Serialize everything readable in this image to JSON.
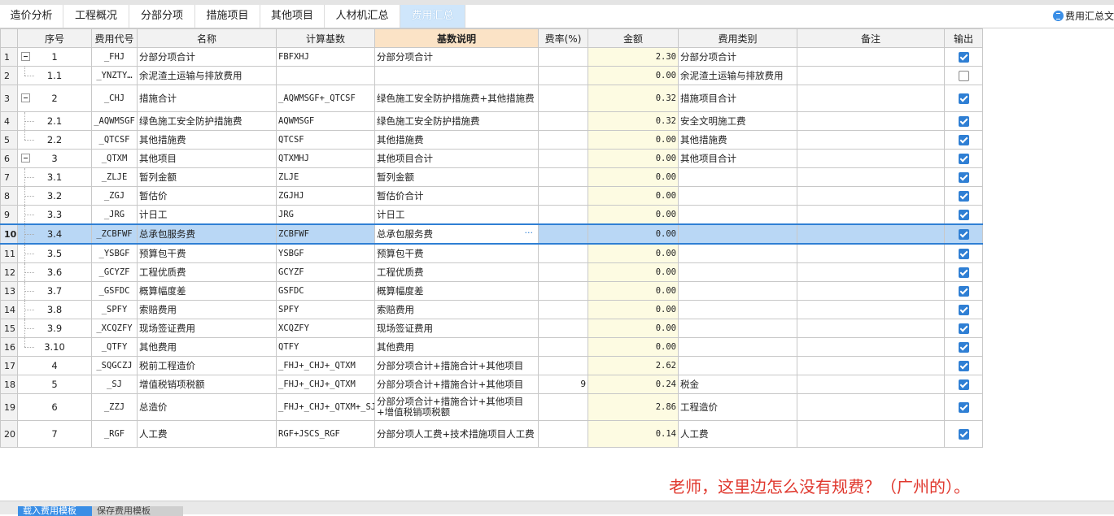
{
  "tabs": [
    {
      "label": "造价分析"
    },
    {
      "label": "工程概况"
    },
    {
      "label": "分部分项"
    },
    {
      "label": "措施项目"
    },
    {
      "label": "其他项目"
    },
    {
      "label": "人材机汇总"
    },
    {
      "label": "费用汇总"
    }
  ],
  "right_link": "费用汇总文",
  "headers": [
    "",
    "序号",
    "费用代号",
    "名称",
    "计算基数",
    "基数说明",
    "费率(%)",
    "金额",
    "费用类别",
    "备注",
    "输出"
  ],
  "rows": [
    {
      "rn": "1",
      "seq": "1",
      "code": "_FHJ",
      "name": "分部分项合计",
      "base": "FBFXHJ",
      "desc": "分部分项合计",
      "rate": "",
      "amount": "2.30",
      "cat": "分部分项合计",
      "note": "",
      "output": true
    },
    {
      "rn": "2",
      "seq": "1.1",
      "code": "_YNZTY…",
      "name": "余泥渣土运输与排放费用",
      "base": "",
      "desc": "",
      "rate": "",
      "amount": "0.00",
      "cat": "余泥渣土运输与排放费用",
      "note": "",
      "output": false
    },
    {
      "rn": "3",
      "seq": "2",
      "code": "_CHJ",
      "name": "措施合计",
      "base": "_AQWMSGF+_QTCSF",
      "desc": "绿色施工安全防护措施费+其他措施费",
      "rate": "",
      "amount": "0.32",
      "cat": "措施项目合计",
      "note": "",
      "output": true
    },
    {
      "rn": "4",
      "seq": "2.1",
      "code": "_AQWMSGF",
      "name": "绿色施工安全防护措施费",
      "base": "AQWMSGF",
      "desc": "绿色施工安全防护措施费",
      "rate": "",
      "amount": "0.32",
      "cat": "安全文明施工费",
      "note": "",
      "output": true
    },
    {
      "rn": "5",
      "seq": "2.2",
      "code": "_QTCSF",
      "name": "其他措施费",
      "base": "QTCSF",
      "desc": "其他措施费",
      "rate": "",
      "amount": "0.00",
      "cat": "其他措施费",
      "note": "",
      "output": true
    },
    {
      "rn": "6",
      "seq": "3",
      "code": "_QTXM",
      "name": "其他项目",
      "base": "QTXMHJ",
      "desc": "其他项目合计",
      "rate": "",
      "amount": "0.00",
      "cat": "其他项目合计",
      "note": "",
      "output": true
    },
    {
      "rn": "7",
      "seq": "3.1",
      "code": "_ZLJE",
      "name": "暂列金额",
      "base": "ZLJE",
      "desc": "暂列金额",
      "rate": "",
      "amount": "0.00",
      "cat": "",
      "note": "",
      "output": true
    },
    {
      "rn": "8",
      "seq": "3.2",
      "code": "_ZGJ",
      "name": "暂估价",
      "base": "ZGJHJ",
      "desc": "暂估价合计",
      "rate": "",
      "amount": "0.00",
      "cat": "",
      "note": "",
      "output": true
    },
    {
      "rn": "9",
      "seq": "3.3",
      "code": "_JRG",
      "name": "计日工",
      "base": "JRG",
      "desc": "计日工",
      "rate": "",
      "amount": "0.00",
      "cat": "",
      "note": "",
      "output": true
    },
    {
      "rn": "10",
      "seq": "3.4",
      "code": "_ZCBFWF",
      "name": "总承包服务费",
      "base": "ZCBFWF",
      "desc": "总承包服务费",
      "rate": "",
      "amount": "0.00",
      "cat": "",
      "note": "",
      "output": true
    },
    {
      "rn": "11",
      "seq": "3.5",
      "code": "_YSBGF",
      "name": "预算包干费",
      "base": "YSBGF",
      "desc": "预算包干费",
      "rate": "",
      "amount": "0.00",
      "cat": "",
      "note": "",
      "output": true
    },
    {
      "rn": "12",
      "seq": "3.6",
      "code": "_GCYZF",
      "name": "工程优质费",
      "base": "GCYZF",
      "desc": "工程优质费",
      "rate": "",
      "amount": "0.00",
      "cat": "",
      "note": "",
      "output": true
    },
    {
      "rn": "13",
      "seq": "3.7",
      "code": "_GSFDC",
      "name": "概算幅度差",
      "base": "GSFDC",
      "desc": "概算幅度差",
      "rate": "",
      "amount": "0.00",
      "cat": "",
      "note": "",
      "output": true
    },
    {
      "rn": "14",
      "seq": "3.8",
      "code": "_SPFY",
      "name": "索赔费用",
      "base": "SPFY",
      "desc": "索赔费用",
      "rate": "",
      "amount": "0.00",
      "cat": "",
      "note": "",
      "output": true
    },
    {
      "rn": "15",
      "seq": "3.9",
      "code": "_XCQZFY",
      "name": "现场签证费用",
      "base": "XCQZFY",
      "desc": "现场签证费用",
      "rate": "",
      "amount": "0.00",
      "cat": "",
      "note": "",
      "output": true
    },
    {
      "rn": "16",
      "seq": "3.10",
      "code": "_QTFY",
      "name": "其他费用",
      "base": "QTFY",
      "desc": "其他费用",
      "rate": "",
      "amount": "0.00",
      "cat": "",
      "note": "",
      "output": true
    },
    {
      "rn": "17",
      "seq": "4",
      "code": "_SQGCZJ",
      "name": "税前工程造价",
      "base": "_FHJ+_CHJ+_QTXM",
      "desc": "分部分项合计+措施合计+其他项目",
      "rate": "",
      "amount": "2.62",
      "cat": "",
      "note": "",
      "output": true
    },
    {
      "rn": "18",
      "seq": "5",
      "code": "_SJ",
      "name": "增值税销项税额",
      "base": "_FHJ+_CHJ+_QTXM",
      "desc": "分部分项合计+措施合计+其他项目",
      "rate": "9",
      "amount": "0.24",
      "cat": "税金",
      "note": "",
      "output": true
    },
    {
      "rn": "19",
      "seq": "6",
      "code": "_ZZJ",
      "name": "总造价",
      "base": "_FHJ+_CHJ+_QTXM+_SJ",
      "desc": "分部分项合计+措施合计+其他项目+增值税销项税额",
      "rate": "",
      "amount": "2.86",
      "cat": "工程造价",
      "note": "",
      "output": true
    },
    {
      "rn": "20",
      "seq": "7",
      "code": "_RGF",
      "name": "人工费",
      "base": "RGF+JSCS_RGF",
      "desc": "分部分项人工费+技术措施项目人工费",
      "rate": "",
      "amount": "0.14",
      "cat": "人工费",
      "note": "",
      "output": true
    }
  ],
  "comment": "老师，这里边怎么没有规费？（广州的）。",
  "bottom_buttons": [
    {
      "label": "载入费用模板"
    },
    {
      "label": "保存费用模板"
    }
  ]
}
